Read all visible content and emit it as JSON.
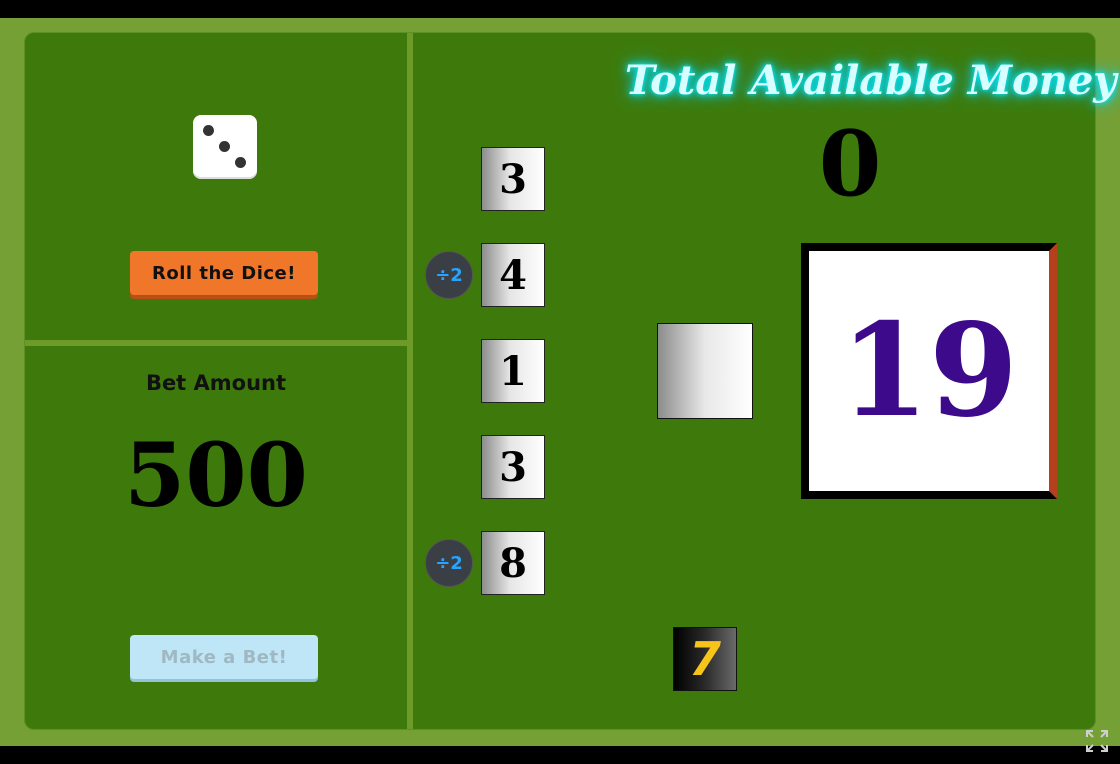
{
  "left_panel": {
    "die_face": 3,
    "roll_button_label": "Roll the Dice!",
    "bet_label": "Bet Amount",
    "bet_value": "500",
    "make_bet_label": "Make a Bet!"
  },
  "tiles": [
    {
      "value": "3",
      "badge": ""
    },
    {
      "value": "4",
      "badge": "÷2"
    },
    {
      "value": "1",
      "badge": ""
    },
    {
      "value": "3",
      "badge": ""
    },
    {
      "value": "8",
      "badge": "÷2"
    }
  ],
  "right_panel": {
    "title": "Total Available Money",
    "money": "0",
    "score": "19",
    "seven": "7"
  },
  "icons": {
    "fullscreen": "fullscreen-icon"
  },
  "colors": {
    "board": "#3d7a0b",
    "frame": "#75a035",
    "roll_button": "#f0762a",
    "bet_button": "#bfe6f7",
    "score_text": "#3c0a8a",
    "seven_text": "#f7c41a",
    "badge_text": "#29a3ff",
    "title_glow": "#00eaff"
  }
}
